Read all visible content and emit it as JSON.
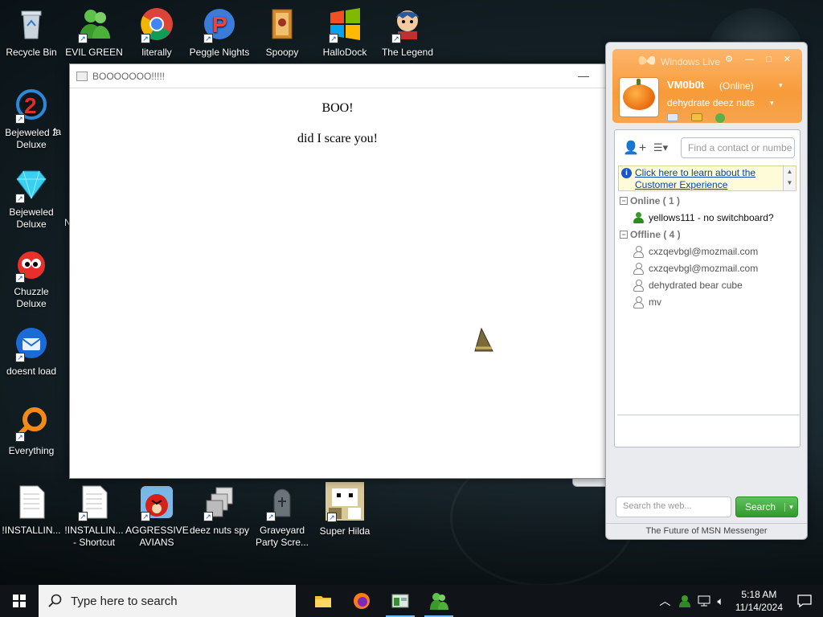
{
  "desktop": {
    "icons": [
      {
        "label": "Recycle Bin",
        "icon": "recycle-bin-icon"
      },
      {
        "label": "EVIL GREEN MEN CO",
        "icon": "msn-people-icon"
      },
      {
        "label": "literally",
        "icon": "chrome-icon"
      },
      {
        "label": "Peggle Nights",
        "icon": "peggle-icon"
      },
      {
        "label": "Spoopy",
        "icon": "folder-icon"
      },
      {
        "label": "HalloDock",
        "icon": "windows-logo-icon"
      },
      {
        "label": "The Legend",
        "icon": "character-icon"
      },
      {
        "label": "Bejeweled 2 Deluxe",
        "icon": "bejeweled2-icon"
      },
      {
        "label": "Bejeweled Deluxe",
        "icon": "bejeweled-gem-icon"
      },
      {
        "label": "Chuzzle Deluxe",
        "icon": "chuzzle-icon"
      },
      {
        "label": "doesnt load",
        "icon": "thunderbird-icon"
      },
      {
        "label": "Everything",
        "icon": "everything-search-icon"
      },
      {
        "label": "!INSTALLIN...",
        "icon": "document-icon"
      },
      {
        "label": "!INSTALLIN... - Shortcut",
        "icon": "document-icon"
      },
      {
        "label": "AGGRESSIVE AVIANS",
        "icon": "angry-birds-icon"
      },
      {
        "label": "deez nuts spy",
        "icon": "windows-stack-icon"
      },
      {
        "label": "Graveyard Party Scre...",
        "icon": "gravestone-icon"
      },
      {
        "label": "Super Hilda",
        "icon": "pixel-hilda-icon"
      }
    ],
    "partial_labels": {
      "left_edge_1": "fa",
      "left_edge_2": "N"
    }
  },
  "dialog": {
    "title": "BOOOOOOO!!!!!",
    "minimize": "—",
    "line1": "BOO!",
    "line2": "did I scare you!"
  },
  "messenger": {
    "title": "Windows Live",
    "controls": "⚙ — □ ✕",
    "user": {
      "name": "VM0b0t",
      "status": "(Online)",
      "personal_message": "dehydrate deez nuts"
    },
    "find_placeholder": "Find a contact or numbe",
    "info_bar": "Click here to learn about the Customer Experience",
    "groups": [
      {
        "name": "Online ( 1 )",
        "contacts": [
          {
            "name": "yellows111 - no switchboard?",
            "online": true
          }
        ]
      },
      {
        "name": "Offline ( 4 )",
        "contacts": [
          {
            "name": "cxzqevbgl@mozmail.com",
            "online": false
          },
          {
            "name": "cxzqevbgl@mozmail.com",
            "online": false
          },
          {
            "name": "dehydrated bear cube",
            "online": false
          },
          {
            "name": "mv",
            "online": false
          }
        ]
      }
    ],
    "web_search_placeholder": "Search the web...",
    "search_button": "Search",
    "footer": "The Future of MSN Messenger"
  },
  "taskbar": {
    "search_placeholder": "Type here to search",
    "time": "5:18 AM",
    "date": "11/14/2024",
    "apps": [
      "file-explorer-icon",
      "firefox-icon",
      "app-window-icon",
      "msn-people-icon"
    ]
  },
  "colors": {
    "msn_orange": "#f79b3a",
    "search_green": "#2f9a2c",
    "taskbar": "#101418"
  }
}
